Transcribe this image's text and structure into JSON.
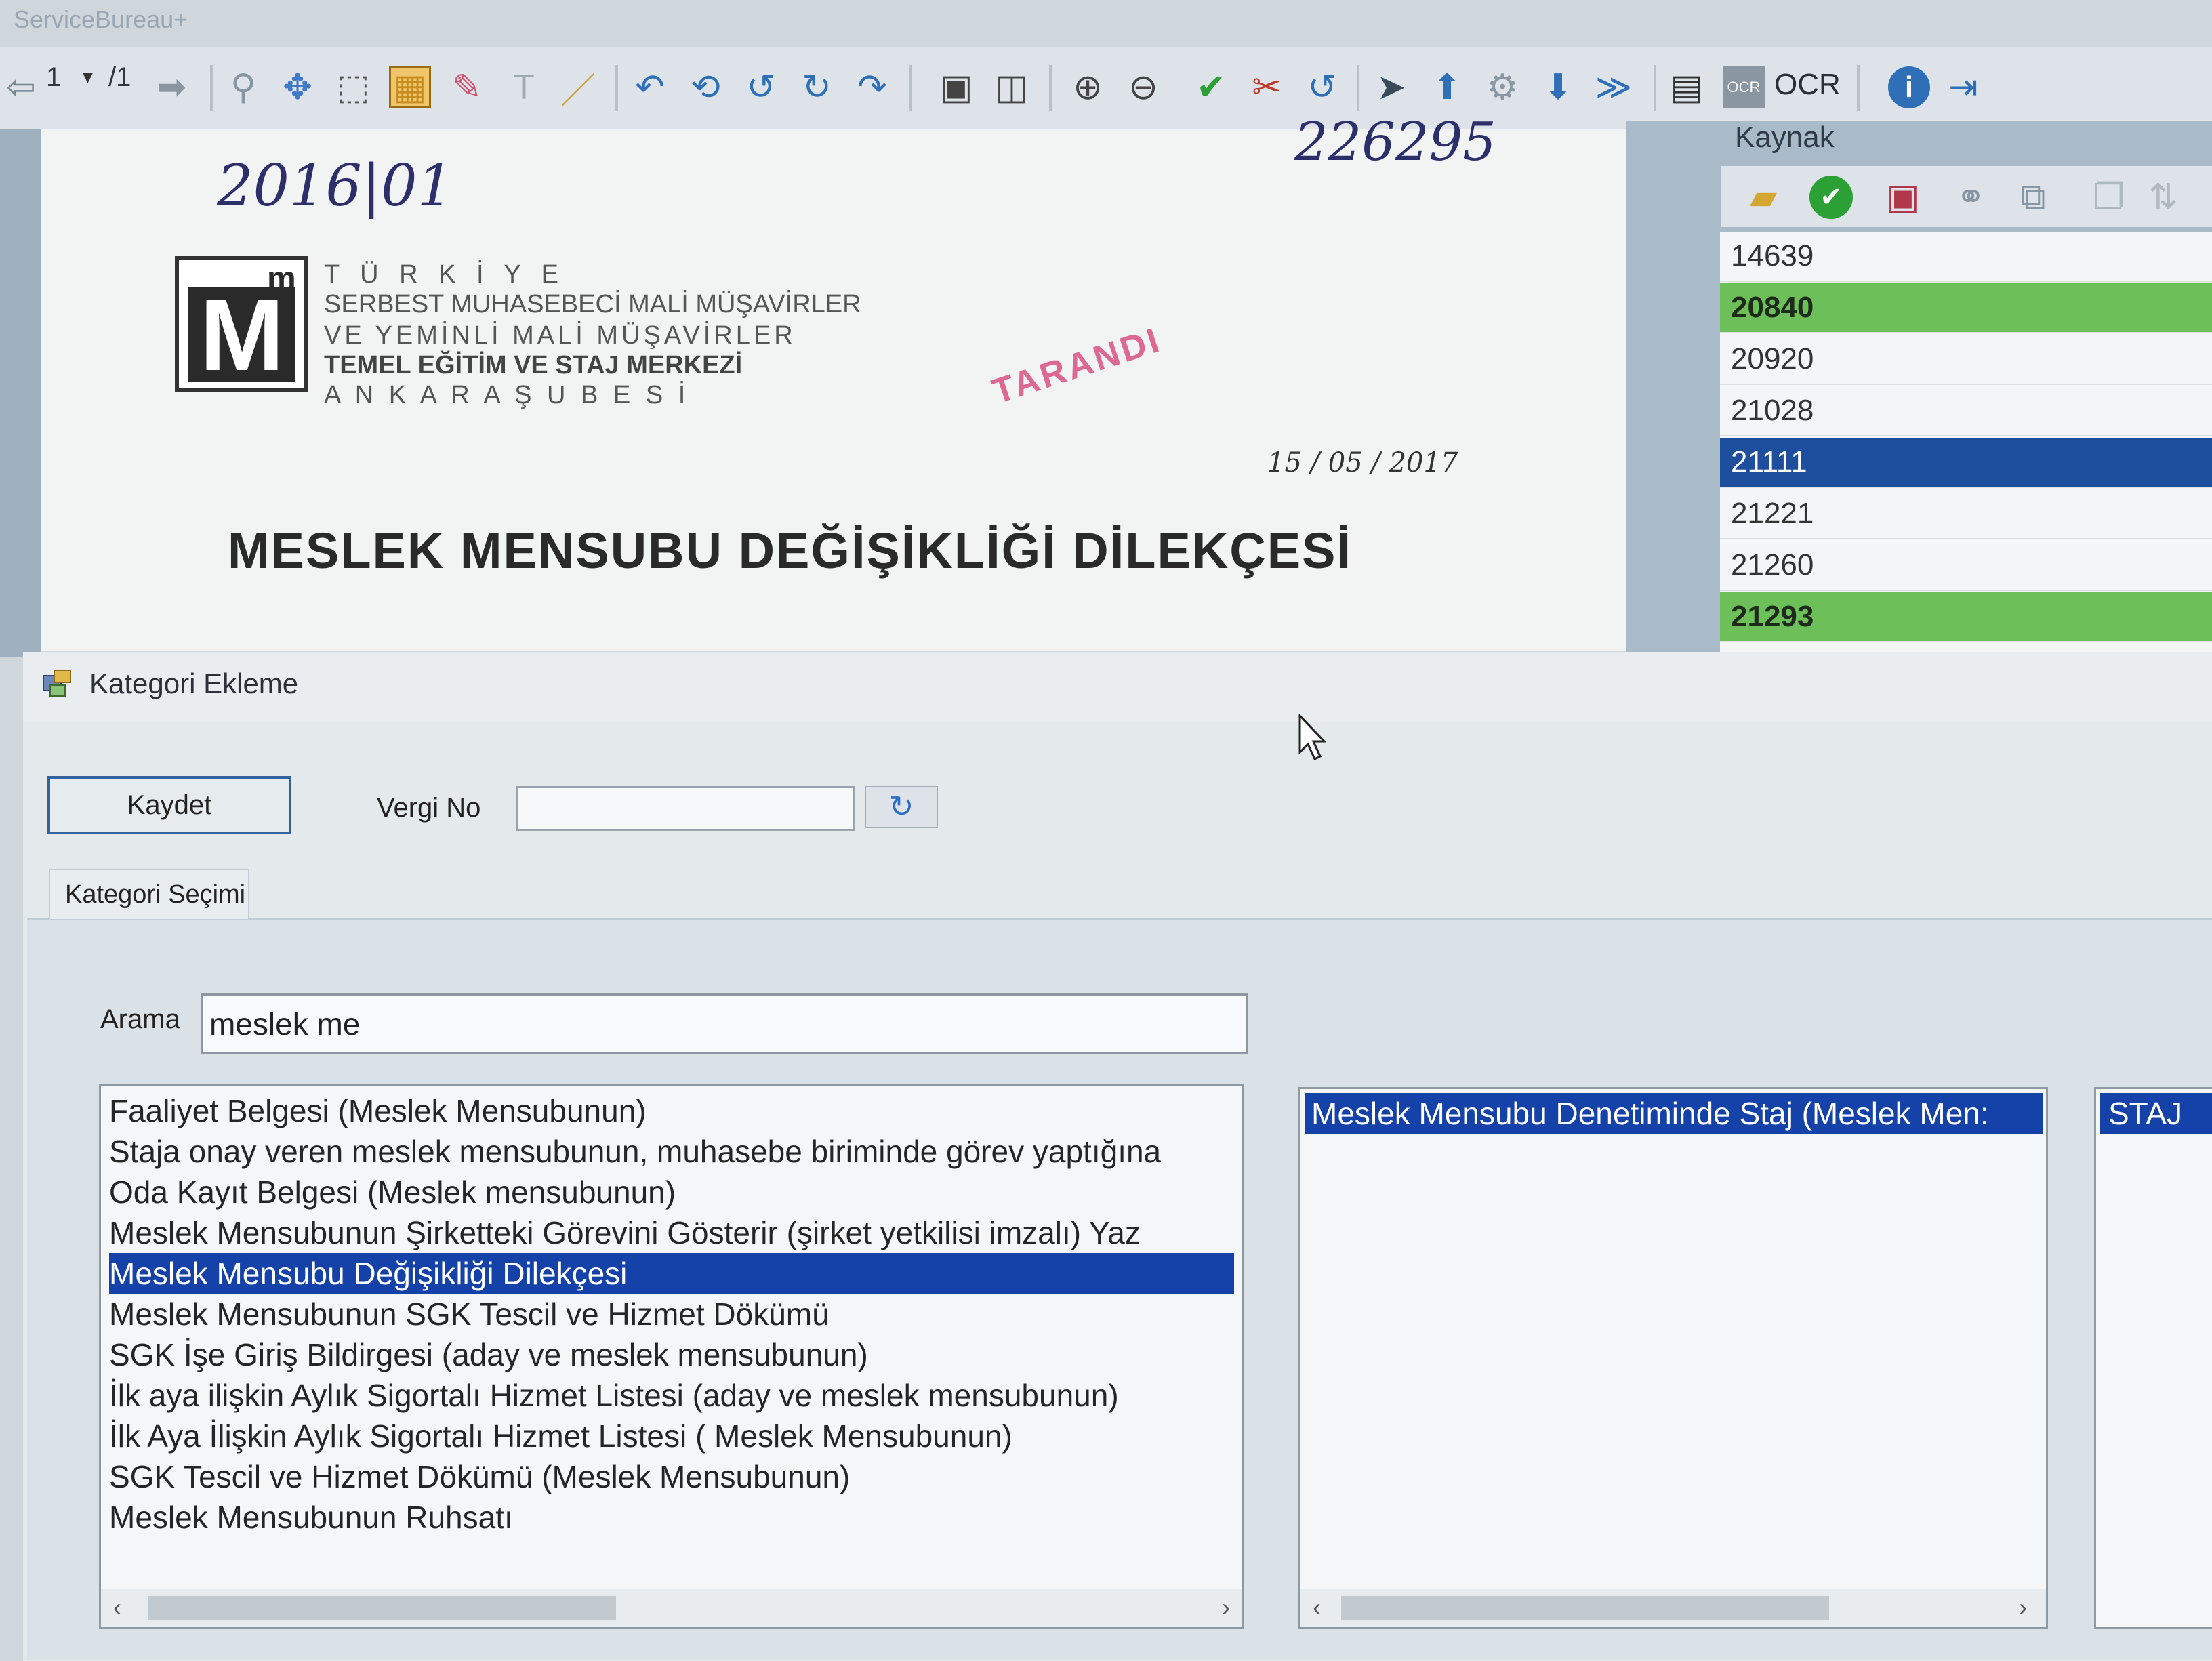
{
  "app": {
    "title": "ServiceBureau+"
  },
  "toolbar": {
    "page_current": "1",
    "page_dropdown": "▾",
    "page_total": "/1",
    "ocr_label": "OCR"
  },
  "document": {
    "handwritten_date": "2016|01",
    "handwritten_number": "226295",
    "logo_letter": "M",
    "logo_sup": "m",
    "org_lines": [
      "T   Ü   R   K   İ   Y   E",
      "SERBEST MUHASEBECİ MALİ MÜŞAVİRLER",
      "VE YEMİNLİ MALİ MÜŞAVİRLER",
      "TEMEL   EĞİTİM   VE   STAJ   MERKEZİ",
      "A N K A R A                          Ş U B E S İ"
    ],
    "stamp_text": "TARANDI",
    "stamp_date": "15 / 05 / 2017",
    "heading": "MESLEK MENSUBU DEĞİŞİKLİĞİ DİLEKÇESİ"
  },
  "kaynak": {
    "title": "Kaynak",
    "rows": [
      {
        "value": "14639",
        "state": "normal"
      },
      {
        "value": "20840",
        "state": "green"
      },
      {
        "value": "20920",
        "state": "normal"
      },
      {
        "value": "21028",
        "state": "normal"
      },
      {
        "value": "21111",
        "state": "selected"
      },
      {
        "value": "21221",
        "state": "normal"
      },
      {
        "value": "21260",
        "state": "normal"
      },
      {
        "value": "21293",
        "state": "green"
      }
    ]
  },
  "dialog": {
    "title": "Kategori Ekleme",
    "save_label": "Kaydet",
    "vergi_label": "Vergi No",
    "vergi_value": "",
    "refresh_icon": "↻",
    "tab_label": "Kategori Seçimi",
    "search_label": "Arama",
    "search_value": "meslek me",
    "categories": [
      "Faaliyet Belgesi (Meslek Mensubunun)",
      "Staja onay veren meslek mensubunun, muhasebe biriminde görev yaptığına",
      "Oda Kayıt Belgesi (Meslek mensubunun)",
      "Meslek Mensubunun Şirketteki Görevini Gösterir (şirket yetkilisi imzalı) Yaz",
      "Meslek Mensubu Değişikliği Dilekçesi",
      "Meslek Mensubunun SGK Tescil ve Hizmet Dökümü",
      "SGK İşe Giriş Bildirgesi (aday ve meslek mensubunun)",
      "İlk aya ilişkin Aylık Sigortalı Hizmet Listesi (aday ve meslek mensubunun)",
      "İlk  Aya İlişkin Aylık Sigortalı Hizmet Listesi ( Meslek Mensubunun)",
      " SGK Tescil ve Hizmet Dökümü (Meslek Mensubunun)",
      "Meslek Mensubunun Ruhsatı"
    ],
    "selected_category_index": 4,
    "selected_list": [
      "Meslek Mensubu Denetiminde Staj (Meslek Men:"
    ],
    "staj_list": [
      "STAJ"
    ]
  },
  "colors": {
    "selection": "#1542a8",
    "kaynak_green": "#6cbf59",
    "kaynak_selected": "#1d4f9e"
  }
}
